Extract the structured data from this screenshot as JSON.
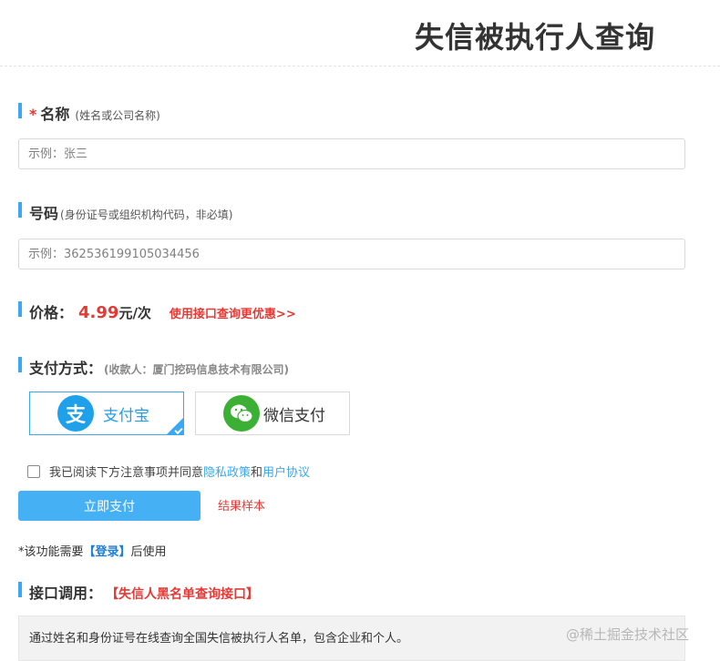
{
  "header": {
    "title": "失信被执行人查询"
  },
  "name_field": {
    "required_mark": "*",
    "label": "名称",
    "hint": "(姓名或公司名称)",
    "placeholder": "示例：张三"
  },
  "id_field": {
    "label": "号码",
    "hint": "(身份证号或组织机构代码，非必填)",
    "placeholder": "示例：362536199105034456"
  },
  "price": {
    "label": "价格：",
    "amount": "4.99",
    "unit": "元/次",
    "api_link": "使用接口查询更优惠>>"
  },
  "payment": {
    "label": "支付方式：",
    "payee": "(收款人：厦门挖码信息技术有限公司)",
    "options": [
      {
        "label": "支付宝",
        "logo_char": "支",
        "icon": "alipay-icon",
        "color": "#1ea0ea",
        "selected": true
      },
      {
        "label": "微信支付",
        "icon": "wechat-icon",
        "color": "#3cb034",
        "selected": false
      }
    ]
  },
  "agreement": {
    "text": "我已阅读下方注意事项并同意",
    "privacy": "隐私政策",
    "and": "和",
    "terms": "用户协议",
    "checked": false
  },
  "actions": {
    "pay_button": "立即支付",
    "sample_link": "结果样本"
  },
  "login_note": {
    "prefix": "*该功能需要",
    "link": "【登录】",
    "suffix": "后使用"
  },
  "api_section": {
    "label": "接口调用：",
    "name": "【失信人黑名单查询接口】",
    "description": "通过姓名和身份证号在线查询全国失信被执行人名单，包含企业和个人。"
  },
  "watermark": "@稀土掘金技术社区",
  "colors": {
    "accent": "#3aa8f2",
    "price_red": "#e53935",
    "alipay": "#1ea0ea",
    "wechat": "#3cb034"
  }
}
